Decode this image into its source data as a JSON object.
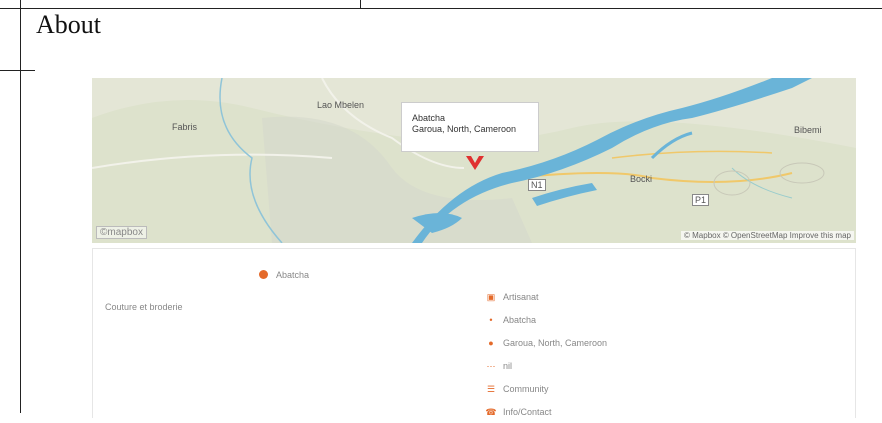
{
  "page": {
    "title": "About"
  },
  "map": {
    "labels": {
      "town_left": "Fabris",
      "town_center": "Lao Mbelen",
      "town_right": "Bibemi",
      "town_mid_right": "Bocki",
      "road_a": "N1",
      "road_b": "P1"
    },
    "popup": {
      "line1": "Abatcha",
      "line2": "Garoua, North, Cameroon"
    },
    "copyright": "©mapbox",
    "attribution": "© Mapbox © OpenStreetMap Improve this map",
    "colors": {
      "land": "#e4e6d6",
      "water": "#6ab4d8",
      "marker": "#e03030"
    }
  },
  "business": {
    "name": "Abatcha",
    "category": "Couture et broderie",
    "details": [
      {
        "icon": "briefcase-icon",
        "text": "Artisanat"
      },
      {
        "icon": "person-icon",
        "text": "Abatcha"
      },
      {
        "icon": "location-pin-icon",
        "text": "Garoua, North, Cameroon"
      },
      {
        "icon": "calendar-icon",
        "text": "nil"
      },
      {
        "icon": "community-icon",
        "text": "Community"
      },
      {
        "icon": "phone-icon",
        "text": "Info/Contact"
      }
    ],
    "accent": "#e46a2a"
  }
}
